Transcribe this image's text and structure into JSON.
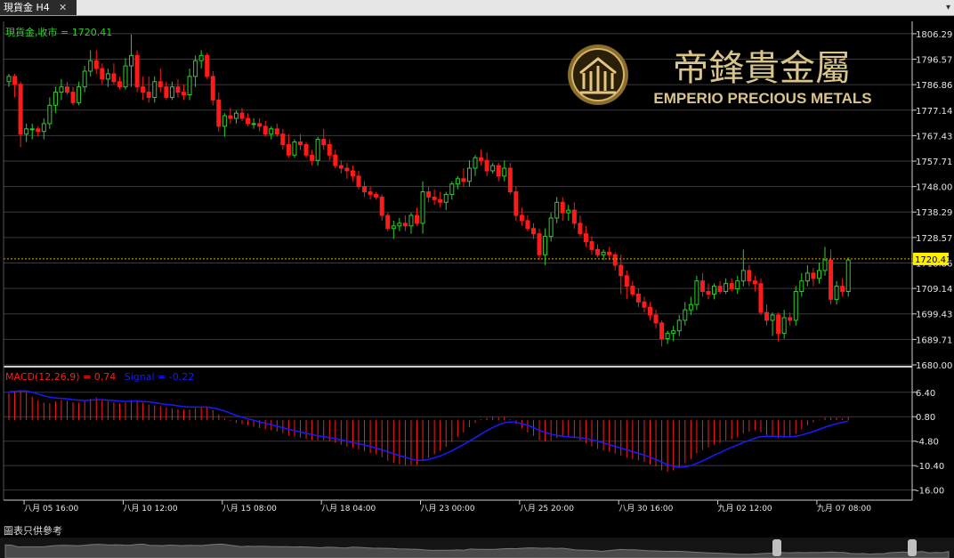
{
  "window": {
    "tab_label": "現貨金 H4",
    "close_glyph": "✕",
    "menu_glyph": "▾"
  },
  "footer": {
    "note": "圖表只供參考"
  },
  "chart_data": [
    {
      "type": "candlestick",
      "label": "現貨金,收市 = 1720.41",
      "last_value": 1720.41,
      "last_value_label": "1720.41",
      "ylim": [
        1680.0,
        1811.0
      ],
      "y_ticks": [
        "1806.29",
        "1796.57",
        "1786.86",
        "1777.14",
        "1767.43",
        "1757.71",
        "1748.00",
        "1738.29",
        "1728.57",
        "1718.86",
        "1709.14",
        "1699.43",
        "1689.71",
        "1680.00"
      ],
      "x_ticks": [
        "八月 05 16:00",
        "八月 10 12:00",
        "八月 15 08:00",
        "八月 18 04:00",
        "八月 23 00:00",
        "八月 25 20:00",
        "八月 30 16:00",
        "九月 02 12:00",
        "九月 07 08:00"
      ],
      "colors": {
        "up": "#2bd02b",
        "down": "#ff1a1a",
        "last_line": "#e0a000",
        "last_box": "#ffee00"
      },
      "ohlc": [
        [
          1788,
          1791,
          1786,
          1790
        ],
        [
          1790,
          1791,
          1782,
          1787
        ],
        [
          1787,
          1788,
          1763,
          1768
        ],
        [
          1768,
          1772,
          1765,
          1770
        ],
        [
          1770,
          1772,
          1766,
          1770
        ],
        [
          1770,
          1771,
          1767,
          1769
        ],
        [
          1769,
          1774,
          1766,
          1772
        ],
        [
          1772,
          1782,
          1770,
          1779
        ],
        [
          1779,
          1786,
          1776,
          1784
        ],
        [
          1784,
          1789,
          1781,
          1786
        ],
        [
          1786,
          1788,
          1783,
          1784
        ],
        [
          1784,
          1786,
          1779,
          1780
        ],
        [
          1780,
          1788,
          1779,
          1786
        ],
        [
          1786,
          1794,
          1784,
          1792
        ],
        [
          1792,
          1800,
          1790,
          1796
        ],
        [
          1796,
          1800,
          1791,
          1793
        ],
        [
          1793,
          1795,
          1787,
          1789
        ],
        [
          1789,
          1793,
          1786,
          1791
        ],
        [
          1791,
          1795,
          1787,
          1788
        ],
        [
          1788,
          1790,
          1785,
          1786
        ],
        [
          1786,
          1797,
          1785,
          1794
        ],
        [
          1794,
          1806,
          1786,
          1798
        ],
        [
          1798,
          1800,
          1784,
          1786
        ],
        [
          1786,
          1790,
          1781,
          1784
        ],
        [
          1784,
          1790,
          1780,
          1782
        ],
        [
          1782,
          1790,
          1780,
          1788
        ],
        [
          1788,
          1793,
          1784,
          1786
        ],
        [
          1786,
          1788,
          1781,
          1782
        ],
        [
          1782,
          1788,
          1781,
          1786
        ],
        [
          1786,
          1789,
          1782,
          1784
        ],
        [
          1784,
          1787,
          1781,
          1783
        ],
        [
          1783,
          1793,
          1781,
          1790
        ],
        [
          1790,
          1798,
          1786,
          1796
        ],
        [
          1796,
          1800,
          1793,
          1798
        ],
        [
          1798,
          1799,
          1789,
          1790
        ],
        [
          1790,
          1792,
          1779,
          1781
        ],
        [
          1781,
          1784,
          1769,
          1771
        ],
        [
          1771,
          1776,
          1767,
          1775
        ],
        [
          1775,
          1778,
          1772,
          1774
        ],
        [
          1774,
          1777,
          1772,
          1776
        ],
        [
          1776,
          1778,
          1773,
          1774
        ],
        [
          1774,
          1776,
          1771,
          1772
        ],
        [
          1772,
          1774,
          1770,
          1772
        ],
        [
          1772,
          1774,
          1769,
          1771
        ],
        [
          1771,
          1773,
          1767,
          1768
        ],
        [
          1768,
          1771,
          1766,
          1770
        ],
        [
          1770,
          1772,
          1767,
          1768
        ],
        [
          1768,
          1770,
          1762,
          1764
        ],
        [
          1764,
          1768,
          1759,
          1760
        ],
        [
          1760,
          1766,
          1759,
          1765
        ],
        [
          1765,
          1768,
          1762,
          1764
        ],
        [
          1764,
          1765,
          1759,
          1760
        ],
        [
          1760,
          1762,
          1756,
          1758
        ],
        [
          1758,
          1767,
          1756,
          1766
        ],
        [
          1766,
          1770,
          1762,
          1764
        ],
        [
          1764,
          1766,
          1758,
          1760
        ],
        [
          1760,
          1762,
          1755,
          1756
        ],
        [
          1756,
          1758,
          1753,
          1755
        ],
        [
          1755,
          1757,
          1751,
          1754
        ],
        [
          1754,
          1756,
          1750,
          1752
        ],
        [
          1752,
          1754,
          1747,
          1748
        ],
        [
          1748,
          1750,
          1744,
          1746
        ],
        [
          1746,
          1748,
          1743,
          1745
        ],
        [
          1745,
          1746,
          1743,
          1744
        ],
        [
          1744,
          1745,
          1735,
          1737
        ],
        [
          1737,
          1738,
          1731,
          1732
        ],
        [
          1732,
          1735,
          1728,
          1733
        ],
        [
          1733,
          1736,
          1731,
          1734
        ],
        [
          1734,
          1737,
          1731,
          1733
        ],
        [
          1733,
          1738,
          1730,
          1737
        ],
        [
          1737,
          1740,
          1733,
          1734
        ],
        [
          1734,
          1750,
          1730,
          1746
        ],
        [
          1746,
          1748,
          1742,
          1744
        ],
        [
          1744,
          1747,
          1741,
          1743
        ],
        [
          1743,
          1746,
          1740,
          1742
        ],
        [
          1742,
          1746,
          1739,
          1745
        ],
        [
          1745,
          1750,
          1743,
          1749
        ],
        [
          1749,
          1752,
          1747,
          1751
        ],
        [
          1751,
          1755,
          1748,
          1750
        ],
        [
          1750,
          1758,
          1748,
          1755
        ],
        [
          1755,
          1760,
          1752,
          1759
        ],
        [
          1759,
          1762,
          1756,
          1758
        ],
        [
          1758,
          1761,
          1752,
          1754
        ],
        [
          1754,
          1757,
          1753,
          1756
        ],
        [
          1756,
          1757,
          1750,
          1752
        ],
        [
          1752,
          1758,
          1750,
          1755
        ],
        [
          1755,
          1757,
          1745,
          1746
        ],
        [
          1746,
          1748,
          1735,
          1737
        ],
        [
          1737,
          1740,
          1733,
          1735
        ],
        [
          1735,
          1737,
          1731,
          1732
        ],
        [
          1732,
          1734,
          1728,
          1730
        ],
        [
          1730,
          1732,
          1720,
          1722
        ],
        [
          1722,
          1732,
          1718,
          1729
        ],
        [
          1729,
          1738,
          1727,
          1736
        ],
        [
          1736,
          1744,
          1734,
          1742
        ],
        [
          1742,
          1744,
          1735,
          1738
        ],
        [
          1738,
          1741,
          1735,
          1739
        ],
        [
          1739,
          1742,
          1732,
          1734
        ],
        [
          1734,
          1737,
          1729,
          1730
        ],
        [
          1730,
          1733,
          1725,
          1727
        ],
        [
          1727,
          1729,
          1722,
          1724
        ],
        [
          1724,
          1726,
          1721,
          1722
        ],
        [
          1722,
          1724,
          1720,
          1723
        ],
        [
          1723,
          1725,
          1720,
          1722
        ],
        [
          1722,
          1723,
          1716,
          1718
        ],
        [
          1718,
          1722,
          1707,
          1714
        ],
        [
          1714,
          1716,
          1705,
          1710
        ],
        [
          1710,
          1712,
          1706,
          1707
        ],
        [
          1707,
          1709,
          1702,
          1704
        ],
        [
          1704,
          1706,
          1700,
          1702
        ],
        [
          1702,
          1704,
          1697,
          1699
        ],
        [
          1699,
          1701,
          1694,
          1696
        ],
        [
          1696,
          1697,
          1687,
          1690
        ],
        [
          1690,
          1693,
          1688,
          1692
        ],
        [
          1692,
          1695,
          1689,
          1693
        ],
        [
          1693,
          1699,
          1691,
          1697
        ],
        [
          1697,
          1704,
          1695,
          1701
        ],
        [
          1701,
          1706,
          1699,
          1703
        ],
        [
          1703,
          1714,
          1701,
          1712
        ],
        [
          1712,
          1715,
          1706,
          1708
        ],
        [
          1708,
          1711,
          1705,
          1707
        ],
        [
          1707,
          1711,
          1705,
          1710
        ],
        [
          1710,
          1712,
          1707,
          1708
        ],
        [
          1708,
          1713,
          1707,
          1711
        ],
        [
          1711,
          1713,
          1708,
          1709
        ],
        [
          1709,
          1714,
          1707,
          1712
        ],
        [
          1712,
          1724,
          1710,
          1716
        ],
        [
          1716,
          1718,
          1710,
          1712
        ],
        [
          1712,
          1714,
          1708,
          1711
        ],
        [
          1711,
          1713,
          1699,
          1700
        ],
        [
          1700,
          1703,
          1695,
          1697
        ],
        [
          1697,
          1700,
          1691,
          1699
        ],
        [
          1699,
          1700,
          1689,
          1692
        ],
        [
          1692,
          1701,
          1690,
          1698
        ],
        [
          1698,
          1700,
          1695,
          1697
        ],
        [
          1697,
          1710,
          1695,
          1708
        ],
        [
          1708,
          1715,
          1706,
          1712
        ],
        [
          1712,
          1718,
          1710,
          1715
        ],
        [
          1715,
          1717,
          1710,
          1713
        ],
        [
          1713,
          1719,
          1711,
          1716
        ],
        [
          1716,
          1725,
          1714,
          1720
        ],
        [
          1720,
          1724,
          1703,
          1705
        ],
        [
          1705,
          1712,
          1703,
          1710
        ],
        [
          1710,
          1713,
          1706,
          1708
        ],
        [
          1708,
          1721,
          1706,
          1720
        ]
      ]
    },
    {
      "type": "macd",
      "label": "MACD(12,26,9) = 0.74",
      "signal_label": "Signal = -0.22",
      "value": 0.74,
      "signal": -0.22,
      "ylim": [
        -17.5,
        9.0
      ],
      "y_ticks": [
        "6.40",
        "0.80",
        "-4.80",
        "-10.40",
        "-16.00"
      ],
      "colors": {
        "macd": "#ff1a1a",
        "signal": "#1a1aff"
      },
      "macd": [
        6.2,
        6.6,
        6.9,
        6.4,
        5.4,
        4.5,
        4.0,
        3.9,
        4.3,
        4.6,
        4.5,
        4.1,
        4.0,
        4.3,
        4.9,
        5.2,
        4.8,
        4.4,
        4.1,
        3.8,
        4.0,
        4.6,
        4.5,
        4.0,
        3.6,
        3.4,
        3.2,
        2.9,
        2.7,
        2.5,
        2.4,
        2.4,
        2.8,
        3.1,
        2.9,
        2.3,
        1.3,
        0.4,
        -0.2,
        -0.6,
        -0.9,
        -1.2,
        -1.5,
        -1.8,
        -2.1,
        -2.3,
        -2.6,
        -3.0,
        -3.5,
        -3.8,
        -4.0,
        -4.3,
        -4.6,
        -4.6,
        -4.6,
        -4.8,
        -5.2,
        -5.6,
        -6.0,
        -6.3,
        -6.7,
        -7.1,
        -7.5,
        -7.8,
        -8.5,
        -9.3,
        -9.8,
        -10.1,
        -10.3,
        -10.3,
        -10.3,
        -9.4,
        -8.6,
        -7.8,
        -7.0,
        -6.1,
        -5.0,
        -3.8,
        -2.8,
        -1.6,
        -0.6,
        0.2,
        0.5,
        0.8,
        0.7,
        0.8,
        0.2,
        -0.9,
        -1.9,
        -2.8,
        -3.6,
        -4.6,
        -4.9,
        -4.7,
        -4.1,
        -3.9,
        -3.8,
        -4.1,
        -4.6,
        -5.3,
        -6.0,
        -6.6,
        -6.9,
        -7.2,
        -7.7,
        -8.1,
        -8.6,
        -8.9,
        -9.2,
        -9.6,
        -10.1,
        -10.6,
        -11.5,
        -11.8,
        -11.5,
        -10.9,
        -9.9,
        -8.9,
        -7.6,
        -6.8,
        -6.2,
        -5.6,
        -5.2,
        -4.7,
        -4.4,
        -3.9,
        -3.0,
        -2.6,
        -2.3,
        -2.8,
        -3.4,
        -3.7,
        -4.1,
        -4.0,
        -3.9,
        -3.1,
        -2.1,
        -1.2,
        -0.5,
        0.1,
        0.6,
        0.6,
        0.6,
        0.4,
        0.74
      ],
      "signal_line": [
        6.5,
        6.6,
        6.7,
        6.7,
        6.4,
        6.0,
        5.6,
        5.3,
        5.1,
        5.0,
        4.9,
        4.7,
        4.6,
        4.5,
        4.6,
        4.7,
        4.7,
        4.6,
        4.5,
        4.4,
        4.3,
        4.4,
        4.4,
        4.3,
        4.2,
        4.0,
        3.8,
        3.6,
        3.5,
        3.3,
        3.1,
        3.0,
        3.0,
        3.0,
        3.0,
        2.8,
        2.5,
        2.1,
        1.6,
        1.1,
        0.7,
        0.3,
        0.0,
        -0.4,
        -0.7,
        -1.0,
        -1.4,
        -1.7,
        -2.1,
        -2.4,
        -2.7,
        -3.0,
        -3.3,
        -3.6,
        -3.8,
        -4.0,
        -4.2,
        -4.5,
        -4.8,
        -5.1,
        -5.4,
        -5.7,
        -6.0,
        -6.4,
        -6.8,
        -7.2,
        -7.7,
        -8.1,
        -8.5,
        -8.9,
        -9.2,
        -9.2,
        -9.0,
        -8.6,
        -8.2,
        -7.6,
        -7.0,
        -6.3,
        -5.6,
        -4.8,
        -4.0,
        -3.2,
        -2.4,
        -1.7,
        -1.1,
        -0.6,
        -0.4,
        -0.5,
        -0.8,
        -1.2,
        -1.7,
        -2.3,
        -2.8,
        -3.2,
        -3.5,
        -3.7,
        -3.8,
        -3.9,
        -4.0,
        -4.2,
        -4.5,
        -4.8,
        -5.2,
        -5.6,
        -6.0,
        -6.4,
        -6.8,
        -7.2,
        -7.6,
        -8.0,
        -8.5,
        -9.0,
        -9.6,
        -10.2,
        -10.6,
        -10.8,
        -10.7,
        -10.4,
        -9.9,
        -9.3,
        -8.7,
        -8.0,
        -7.4,
        -6.8,
        -6.2,
        -5.7,
        -5.1,
        -4.6,
        -4.1,
        -3.8,
        -3.7,
        -3.7,
        -3.7,
        -3.8,
        -3.8,
        -3.7,
        -3.4,
        -3.0,
        -2.6,
        -2.1,
        -1.6,
        -1.2,
        -0.8,
        -0.5,
        -0.22
      ]
    }
  ],
  "logo": {
    "name_chinese": "帝鋒貴金屬",
    "name_english": "EMPERIO PRECIOUS METALS",
    "emblem": "crest-emblem-icon"
  }
}
